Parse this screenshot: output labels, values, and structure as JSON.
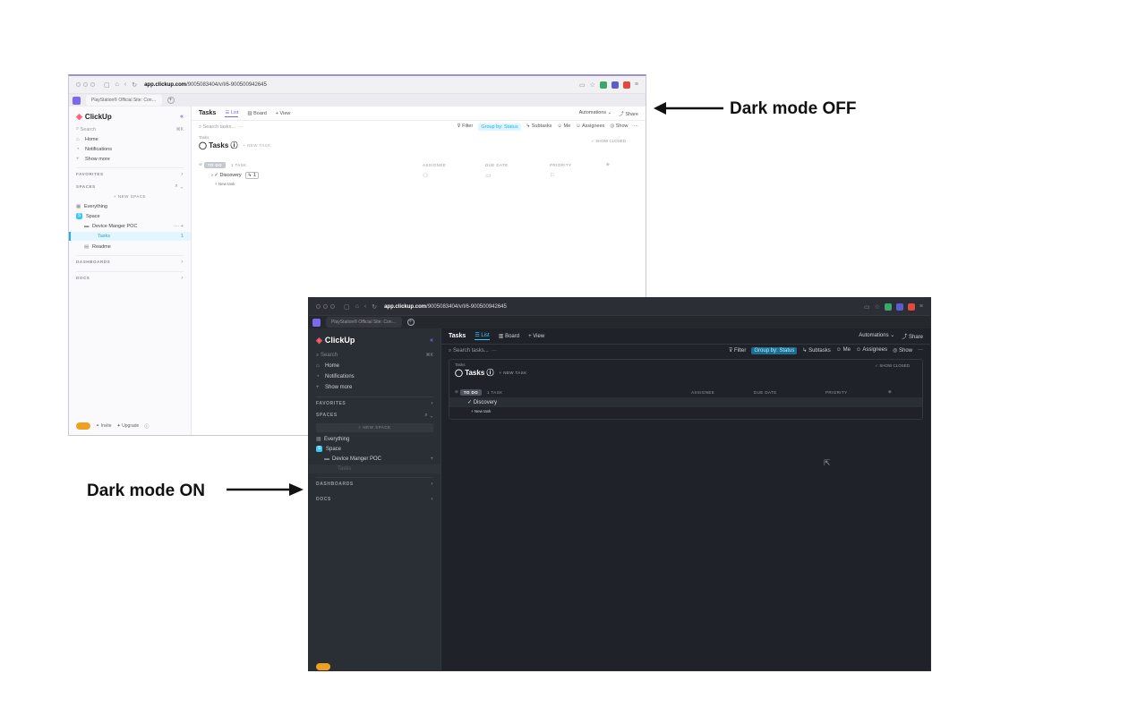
{
  "annotations": {
    "light_label": "Dark mode OFF",
    "dark_label": "Dark mode ON"
  },
  "browser": {
    "url_host": "app.clickup.com",
    "url_path": "/9005083404/v/l/6-900500942645",
    "tab_title": "PlayStation® Official Site: Con…"
  },
  "app": {
    "brand": "ClickUp",
    "search_placeholder": "Search",
    "search_shortcut": "⌘K",
    "nav": [
      "Home",
      "Notifications",
      "Show more"
    ],
    "favorites_label": "FAVORITES",
    "spaces_label": "SPACES",
    "new_space_label": "+ NEW SPACE",
    "everything_label": "Everything",
    "space_label": "Space",
    "folder_label": "Device Manger POC",
    "list_label": "Tasks",
    "readme_label": "Readme",
    "dashboards_label": "DASHBOARDS",
    "docs_label": "DOCS",
    "invite_label": "Invite",
    "upgrade_label": "Upgrade"
  },
  "main": {
    "title": "Tasks",
    "tabs": [
      "List",
      "Board",
      "+ View"
    ],
    "automations_label": "Automations",
    "share_label": "Share",
    "search_tasks_placeholder": "Search tasks...",
    "filter_label": "Filter",
    "group_by_label": "Group by: Status",
    "subtasks_label": "Subtasks",
    "me_label": "Me",
    "assignees_label": "Assignees",
    "show_label": "Show",
    "breadcrumb": "Tasks",
    "list_title": "Tasks",
    "new_task_header": "+ NEW TASK",
    "show_closed": "SHOW CLOSED",
    "status_label": "TO DO",
    "task_count": "1 TASK",
    "columns": [
      "ASSIGNEE",
      "DUE DATE",
      "PRIORITY"
    ],
    "task_name": "Discovery",
    "subtask_count": "1",
    "new_task_row": "+ New task"
  }
}
